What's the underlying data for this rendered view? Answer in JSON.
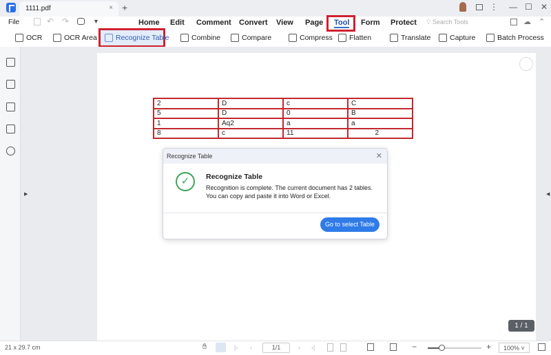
{
  "titlebar": {
    "tab": "1111.pdf",
    "close": "×",
    "new_tab": "+",
    "minimize": "—",
    "maximize": "☐",
    "close_window": "✕",
    "more": "⋮"
  },
  "menu": {
    "file": "File",
    "items": [
      "Home",
      "Edit",
      "Comment",
      "Convert",
      "View",
      "Page",
      "Tool",
      "Form",
      "Protect"
    ],
    "active": "Tool",
    "search_placeholder": "Search Tools"
  },
  "toolbar": {
    "items": [
      "OCR",
      "OCR Area",
      "Recognize Table",
      "Combine",
      "Compare",
      "Compress",
      "Flatten",
      "Translate",
      "Capture",
      "Batch Process"
    ],
    "active": "Recognize Table"
  },
  "table": {
    "rows": [
      [
        "2",
        "D",
        "c",
        "C"
      ],
      [
        "5",
        "D",
        "0",
        "B"
      ],
      [
        "1",
        "Aq2",
        "a",
        "a"
      ],
      [
        "8",
        "c",
        "11",
        "2"
      ]
    ]
  },
  "dialog": {
    "header": "Recognize Table",
    "title": "Recognize Table",
    "message": "Recognition is complete. The current document has 2 tables. You can copy and paste it into Word or Excel.",
    "button": "Go to select Table",
    "close": "✕",
    "check": "✓"
  },
  "page_counter": "1 / 1",
  "status": {
    "size": "21 x 29.7 cm",
    "page_input": "1/1",
    "zoom": "100%",
    "zoom_level_fraction": 0.25
  },
  "colors": {
    "accent": "#2f7be8",
    "highlight": "#d0202f",
    "success": "#3aa655",
    "table_border": "#c1272d"
  }
}
